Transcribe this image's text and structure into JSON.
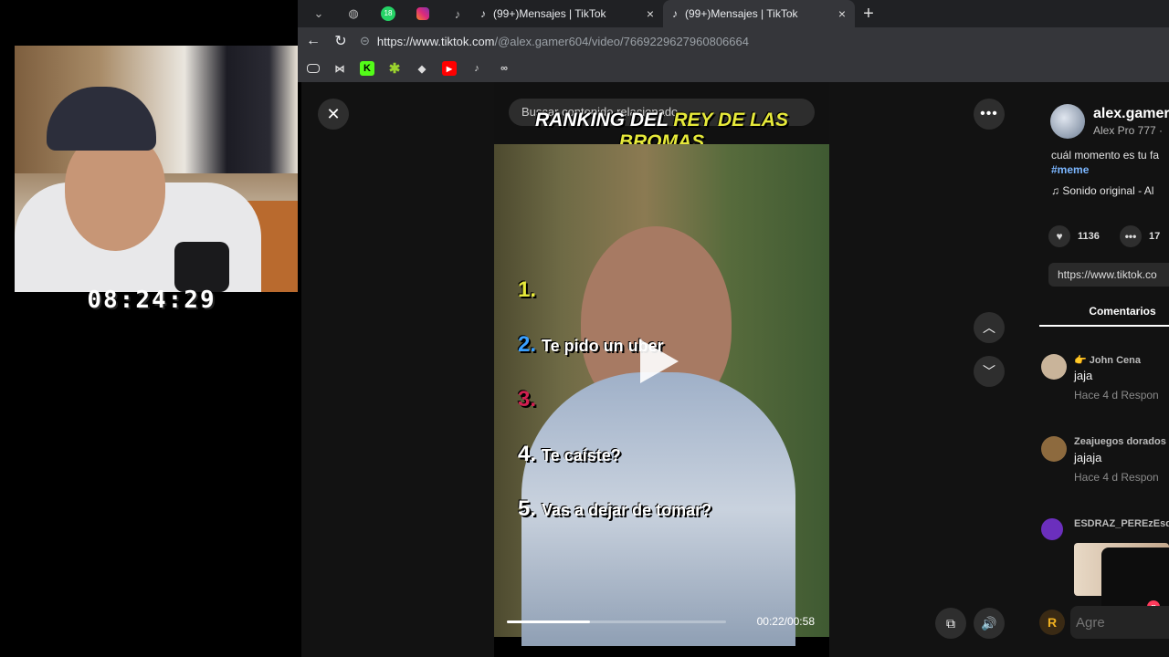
{
  "webcam": {
    "clock": "08:24:29"
  },
  "browser": {
    "tabs": [
      {
        "title": "(99+)Mensajes | TikTok",
        "close": "×"
      },
      {
        "title": "(99+)Mensajes | TikTok",
        "close": "×"
      }
    ],
    "pinned_badge": "18",
    "new_tab": "+",
    "url_host": "https://www.tiktok.com",
    "url_path": "/@alex.gamer604/video/7669229627960806664"
  },
  "video": {
    "search_placeholder": "Buscar contenido relacionado",
    "headline_white": "RANKING DEL ",
    "headline_yellow": "REY DE LAS BROMAS",
    "items": [
      {
        "num": "1.",
        "text": "",
        "color": "#e6e93a"
      },
      {
        "num": "2.",
        "text": "Te pido un uber",
        "color": "#3aa0ff"
      },
      {
        "num": "3.",
        "text": "",
        "color": "#d02050"
      },
      {
        "num": "4.",
        "text": "Te caíste?",
        "color": "#ffffff"
      },
      {
        "num": "5.",
        "text": "Vas a dejar de tomar?",
        "color": "#ffffff"
      }
    ],
    "timecode": "00:22/00:58",
    "progress": 0.38
  },
  "panel": {
    "username": "alex.gamer",
    "subname": "Alex Pro 777 · ",
    "caption": "cuál momento es tu fa",
    "hashtag": "#meme",
    "sound": "Sonido original - Al",
    "likes": "1136",
    "comments_count": "17",
    "link": "https://www.tiktok.co",
    "comments_tab": "Comentarios",
    "comments": [
      {
        "user": "👉 John Cena",
        "text": "jaja",
        "meta": "Hace 4 d   Respon",
        "avatar_color": "#c9b49a"
      },
      {
        "user": "Zeajuegos dorados",
        "text": "jajaja",
        "meta": "Hace 4 d   Respon",
        "avatar_color": "#8d6a3e"
      },
      {
        "user": "ESDRAZ_PEREzEsd",
        "text": "",
        "meta": "",
        "avatar_color": "#6b2fbd"
      }
    ],
    "add_comment_placeholder": "Agre"
  },
  "icons": {
    "close": "✕",
    "more": "•••",
    "chevron_up": "︿",
    "chevron_down": "﹀",
    "volume": "🔊",
    "pip": "⧉",
    "heart": "♥",
    "comment": "•••",
    "music": "♫",
    "back": "←",
    "reload": "↻",
    "lock": "⊝"
  },
  "colors": {
    "accent": "#fe2c55",
    "hashtag": "#7bb6ff"
  }
}
